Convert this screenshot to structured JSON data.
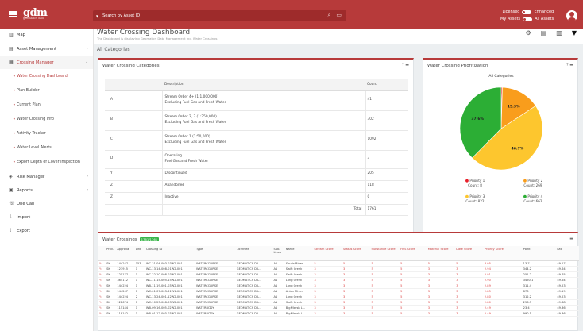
{
  "topbar": {
    "logo": "gdm",
    "logo_sub": "geomatics data",
    "search": "Search by Asset ID",
    "toggle_licensed": "Licensed",
    "toggle_enhanced": "Enhanced",
    "toggle_myassets": "My Assets",
    "toggle_allassets": "All Assets"
  },
  "sidebar": {
    "map": "Map",
    "asset_management": "Asset Management",
    "crossing_manager": "Crossing Manager",
    "items": [
      "Water Crossing Dashboard",
      "Plan Builder",
      "Current Plan",
      "Water Crossing Info",
      "Activity Tracker",
      "Water Level Alerts",
      "Export Depth of Cover Inspection"
    ],
    "risk_manager": "Risk Manager",
    "reports": "Reports",
    "one_call": "One Call",
    "import": "Import",
    "export": "Export"
  },
  "page": {
    "title": "Water Crossing Dashboard",
    "subtitle": "The Dashboard is displaying Geomatics Data Management Inc. Water Crossings",
    "crumb": "All Categories"
  },
  "categories": {
    "title": "Water Crossing Categories",
    "col_description": "Description",
    "col_count": "Count",
    "rows": [
      {
        "key": "A",
        "line1": "Stream Order 4+ (1:1,000,000)",
        "line2": "Excluding Fuel Gas and Fresh Water",
        "count": "41"
      },
      {
        "key": "B",
        "line1": "Stream Order 2, 3 (1:250,000)",
        "line2": "Excluding Fuel Gas and Fresh Water",
        "count": "302"
      },
      {
        "key": "C",
        "line1": "Stream Order 1 (1:50,000)",
        "line2": "Excluding Fuel Gas and Fresh Water",
        "count": "1092"
      },
      {
        "key": "D",
        "line1": "Operating",
        "line2": "Fuel Gas and Fresh Water",
        "count": "3"
      },
      {
        "key": "Y",
        "line1": "Discontinued",
        "line2": "",
        "count": "205"
      },
      {
        "key": "Z",
        "line1": "Abandoned",
        "line2": "",
        "count": "118"
      },
      {
        "key": "Z",
        "line1": "Inactive",
        "line2": "",
        "count": "0"
      }
    ],
    "total_label": "Total",
    "total": "1761"
  },
  "prioritization": {
    "title": "Water Crossing Prioritization",
    "chart_label": "All Categories",
    "legend": [
      {
        "name": "Priority 1",
        "count": "Count: 8"
      },
      {
        "name": "Priority 2",
        "count": "Count: 269"
      },
      {
        "name": "Priority 3",
        "count": "Count: 822"
      },
      {
        "name": "Priority 4",
        "count": "Count: 662"
      }
    ]
  },
  "chart_data": {
    "type": "pie",
    "title": "All Categories",
    "series": [
      {
        "name": "Priority 1",
        "value": 8,
        "label": "",
        "color": "#e8202a"
      },
      {
        "name": "Priority 2",
        "value": 269,
        "label": "15.3%",
        "color": "#f99d1c"
      },
      {
        "name": "Priority 3",
        "value": 822,
        "label": "46.7%",
        "color": "#fdc62e"
      },
      {
        "name": "Priority 4",
        "value": 662,
        "label": "37.6%",
        "color": "#2cae35"
      }
    ]
  },
  "crossings": {
    "title": "Water Crossings",
    "badge": "1761/1761",
    "headers": [
      "",
      "Prov.",
      "Approval",
      "Line",
      "Crossing ID",
      "Type",
      "Licensee",
      "Sub. Lines",
      "Name",
      "Stream Score",
      "Status Score",
      "Substance Score",
      "H2S Score",
      "Material Score",
      "Date Score",
      "Priority Score",
      "Point",
      "Lat."
    ],
    "rows": [
      [
        "✎",
        "SK",
        "144247",
        "153",
        "WC-31-04-003-03W2-001",
        "WATERCOURSE",
        "GEOMATICS DA...",
        "A1",
        "Souris River",
        "5",
        "5",
        "5",
        "5",
        "5",
        "5",
        "3.05",
        "13.7",
        "49.17"
      ],
      [
        "✎",
        "SK",
        "121915",
        "1",
        "WC-13-14-008-01W2-001",
        "WATERCOURSE",
        "GEOMATICS DA...",
        "A1",
        "Swift Creek",
        "3",
        "3",
        "5",
        "5",
        "3",
        "3",
        "2.94",
        "344.2",
        "49.64"
      ],
      [
        "✎",
        "SK",
        "125177",
        "1",
        "WC-22-10-008-03W2-001",
        "WATERCOURSE",
        "GEOMATICS DA...",
        "A1",
        "Swift Creek",
        "3",
        "3",
        "5",
        "5",
        "3",
        "3",
        "2.91",
        "251.2",
        "49.65"
      ],
      [
        "✎",
        "SK",
        "365112",
        "1",
        "WC-11-15-005-15W2-001",
        "WATERCOURSE",
        "GEOMATICS DA...",
        "A1",
        "Long Creek",
        "3",
        "3",
        "5",
        "5",
        "3",
        "3",
        "2.90",
        "3450.1",
        "49.64"
      ],
      [
        "✎",
        "SK",
        "144224",
        "1",
        "WB-11-19-001-03W2-001",
        "WATERCOURSE",
        "GEOMATICS DA...",
        "A1",
        "Long Creek",
        "3",
        "3",
        "5",
        "5",
        "3",
        "3",
        "2.89",
        "311.4",
        "49.23"
      ],
      [
        "✎",
        "SK",
        "144207",
        "1",
        "WC-01-07-003-31W1-001",
        "WATERCOURSE",
        "GEOMATICS DA...",
        "A1",
        "Antler River",
        "3",
        "3",
        "5",
        "5",
        "3",
        "3",
        "2.85",
        "873",
        "49.19"
      ],
      [
        "✎",
        "SK",
        "144224",
        "2",
        "WC-13-24-001-12W2-001",
        "WATERCOURSE",
        "GEOMATICS DA...",
        "A1",
        "Long Creek",
        "3",
        "3",
        "5",
        "5",
        "3",
        "3",
        "2.80",
        "312.2",
        "49.23"
      ],
      [
        "✎",
        "SK",
        "122674",
        "1",
        "WC-10-23-008-03W2-001",
        "WATERCOURSE",
        "GEOMATICS DA...",
        "A1",
        "Swift Creek",
        "3",
        "3",
        "5",
        "5",
        "3",
        "3",
        "2.80",
        "256.3",
        "49.68"
      ],
      [
        "✎",
        "SK",
        "115144",
        "1",
        "WB-09-16-005-02W2-001",
        "WATERBODY",
        "GEOMATICS DA...",
        "A1",
        "Big Marsh L...",
        "3",
        "3",
        "5",
        "5",
        "3",
        "3",
        "2.49",
        "23.4",
        "49.36"
      ],
      [
        "✎",
        "SK",
        "118142",
        "1",
        "WB-01-12-003-03W2-001",
        "WATERBODY",
        "GEOMATICS DA...",
        "A1",
        "Big Marsh L...",
        "3",
        "3",
        "5",
        "5",
        "3",
        "3",
        "2.49",
        "990.1",
        "49.36"
      ]
    ]
  }
}
